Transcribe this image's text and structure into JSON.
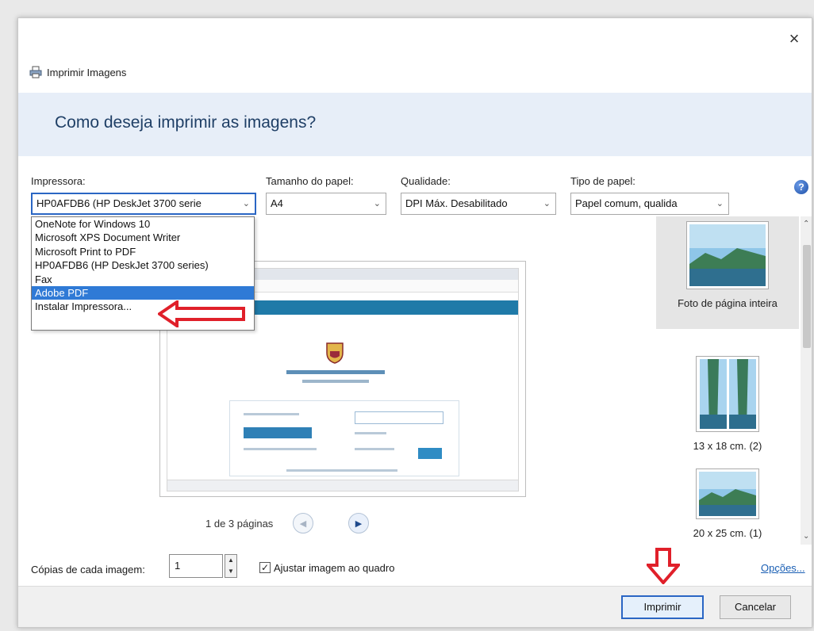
{
  "window": {
    "title": "Imprimir Imagens",
    "close_glyph": "×",
    "help_glyph": "?"
  },
  "header": {
    "question": "Como deseja imprimir as imagens?"
  },
  "options": {
    "printer_label": "Impressora:",
    "printer_value": "HP0AFDB6 (HP DeskJet 3700 serie",
    "paper_size_label": "Tamanho do papel:",
    "paper_size_value": "A4",
    "quality_label": "Qualidade:",
    "quality_value": "DPI Máx. Desabilitado",
    "paper_type_label": "Tipo de papel:",
    "paper_type_value": "Papel comum, qualida"
  },
  "printer_dropdown": {
    "items": [
      "OneNote for Windows 10",
      "Microsoft XPS Document Writer",
      "Microsoft Print to PDF",
      "HP0AFDB6 (HP DeskJet 3700 series)",
      "Fax",
      "Adobe PDF",
      "Instalar Impressora..."
    ],
    "highlighted": "Adobe PDF"
  },
  "preview": {
    "page_indicator": "1 de 3 páginas"
  },
  "layouts": [
    {
      "label": "Foto de página inteira"
    },
    {
      "label": "13 x 18 cm. (2)"
    },
    {
      "label": "20 x 25 cm. (1)"
    }
  ],
  "bottom": {
    "copies_label": "Cópias de cada imagem:",
    "copies_value": "1",
    "fit_label": "Ajustar imagem ao quadro",
    "fit_checked": true,
    "options_link": "Opções..."
  },
  "footer": {
    "print_button": "Imprimir",
    "cancel_button": "Cancelar"
  },
  "colors": {
    "annotation_red": "#e0202a",
    "selection_blue": "#2f7ad6",
    "header_band": "#e7eef8"
  }
}
